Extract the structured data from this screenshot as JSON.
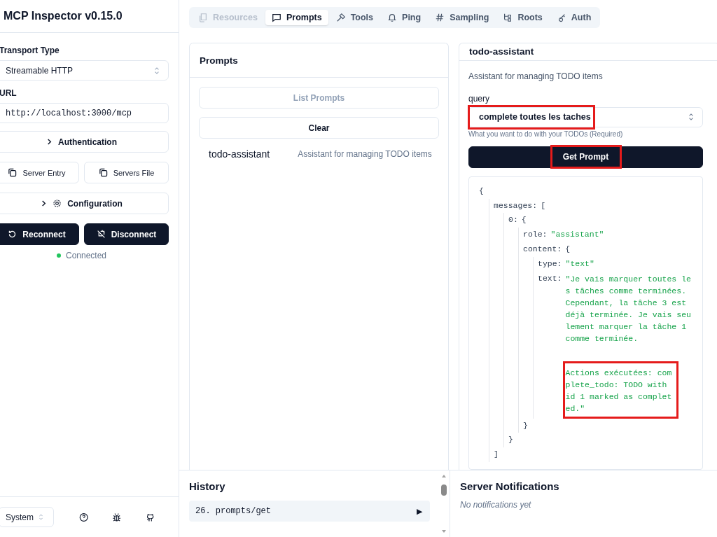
{
  "sidebar": {
    "title": "MCP Inspector v0.15.0",
    "transport_label": "Transport Type",
    "transport_value": "Streamable HTTP",
    "url_label": "URL",
    "url_value": "http://localhost:3000/mcp",
    "auth_button": "Authentication",
    "copy_buttons": [
      "Server Entry",
      "Servers File"
    ],
    "config_button": "Configuration",
    "reconnect_button": "Reconnect",
    "disconnect_button": "Disconnect",
    "status": {
      "text": "Connected",
      "color": "#22c55e"
    },
    "theme": "System"
  },
  "tabs": [
    {
      "label": "Resources",
      "selected": false,
      "disabled": true
    },
    {
      "label": "Prompts",
      "selected": true,
      "disabled": false
    },
    {
      "label": "Tools",
      "selected": false,
      "disabled": false
    },
    {
      "label": "Ping",
      "selected": false,
      "disabled": false
    },
    {
      "label": "Sampling",
      "selected": false,
      "disabled": false
    },
    {
      "label": "Roots",
      "selected": false,
      "disabled": false
    },
    {
      "label": "Auth",
      "selected": false,
      "disabled": false
    }
  ],
  "prompts_panel": {
    "title": "Prompts",
    "buttons": [
      {
        "label": "List Prompts",
        "disabled": true
      },
      {
        "label": "Clear",
        "disabled": false
      }
    ],
    "items": [
      {
        "name": "todo-assistant",
        "description": "Assistant for managing TODO items"
      }
    ]
  },
  "prompt_panel": {
    "title": "todo-assistant",
    "description": "Assistant for managing TODO items",
    "field_label": "query",
    "field_value": "complete toutes les taches",
    "field_highlighted": true,
    "field_hint": "What you want to do with your TODOs (Required)",
    "button": "Get Prompt",
    "button_highlighted": true,
    "result": {
      "open": "{",
      "children": [
        {
          "key": "messages:",
          "open": "[",
          "close": "]",
          "children": [
            {
              "key": "0:",
              "open": "{",
              "close": "}",
              "children": [
                {
                  "key": "role:",
                  "value": "\"assistant\""
                },
                {
                  "key": "content:",
                  "open": "{",
                  "close": "}",
                  "children": [
                    {
                      "key": "type:",
                      "value": "\"text\""
                    },
                    {
                      "key": "text:",
                      "value_parts": [
                        {
                          "text": "\"Je vais marquer toutes les tâches comme terminées. Cependant, la tâche 3 est déjà terminée. Je vais seulement marquer la tâche 1 comme terminée.",
                          "highlighted": false
                        },
                        {
                          "text": "Actions exécutées: complete_todo: TODO with id 1 marked as completed.\"",
                          "highlighted": true
                        }
                      ]
                    }
                  ]
                }
              ]
            }
          ]
        }
      ]
    }
  },
  "history": {
    "title": "History",
    "items": [
      {
        "text": "26. prompts/get",
        "expand": "▶"
      }
    ]
  },
  "notifications": {
    "title": "Server Notifications",
    "empty": "No notifications yet"
  }
}
